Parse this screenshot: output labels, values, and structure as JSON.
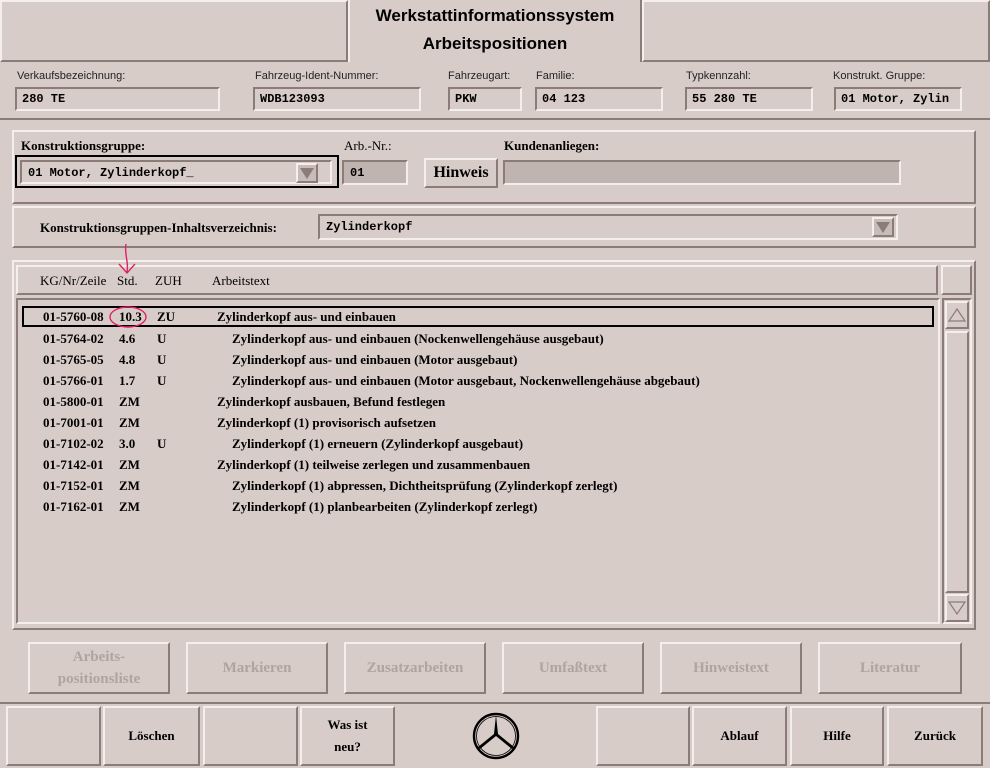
{
  "header": {
    "title_line1": "Werkstattinformationssystem",
    "title_line2": "Arbeitspositionen"
  },
  "vehicle": {
    "verkauf_label": "Verkaufsbezeichnung:",
    "verkauf_value": "280 TE",
    "fin_label": "Fahrzeug-Ident-Nummer:",
    "fin_value": "WDB123093",
    "art_label": "Fahrzeugart:",
    "art_value": "PKW",
    "familie_label": "Familie:",
    "familie_value": "04 123",
    "typ_label": "Typkennzahl:",
    "typ_value": "55 280 TE",
    "kg_label": "Konstrukt. Gruppe:",
    "kg_value": "01 Motor, Zylin"
  },
  "group": {
    "kg_label": "Konstruktionsgruppe:",
    "kg_value": "01 Motor, Zylinderkopf_",
    "arbnr_label": "Arb.-Nr.:",
    "arbnr_value": "01",
    "hinweis_label": "Hinweis",
    "kunden_label": "Kundenanliegen:",
    "kunden_value": ""
  },
  "contents": {
    "label": "Konstruktionsgruppen-Inhaltsverzeichnis:",
    "value": "Zylinderkopf"
  },
  "table": {
    "headers": {
      "kg": "KG/Nr/Zeile",
      "std": "Std.",
      "zuh": "ZUH",
      "text": "Arbeitstext"
    },
    "rows": [
      {
        "kg": "01-5760-08",
        "std": "10.3",
        "zuh": "ZU",
        "text": "Zylinderkopf aus- und einbauen",
        "indent": 0,
        "selected": true
      },
      {
        "kg": "01-5764-02",
        "std": "4.6",
        "zuh": "U",
        "text": "Zylinderkopf aus- und einbauen (Nockenwellengehäuse ausgebaut)",
        "indent": 1
      },
      {
        "kg": "01-5765-05",
        "std": "4.8",
        "zuh": "U",
        "text": "Zylinderkopf aus- und einbauen (Motor ausgebaut)",
        "indent": 1
      },
      {
        "kg": "01-5766-01",
        "std": "1.7",
        "zuh": "U",
        "text": "Zylinderkopf aus- und einbauen (Motor ausgebaut, Nockenwellengehäuse abgebaut)",
        "indent": 1
      },
      {
        "kg": "01-5800-01",
        "std": "ZM",
        "zuh": "",
        "text": "Zylinderkopf ausbauen, Befund festlegen",
        "indent": 0
      },
      {
        "kg": "01-7001-01",
        "std": "ZM",
        "zuh": "",
        "text": "Zylinderkopf (1) provisorisch aufsetzen",
        "indent": 0
      },
      {
        "kg": "01-7102-02",
        "std": "3.0",
        "zuh": "U",
        "text": "Zylinderkopf (1) erneuern (Zylinderkopf ausgebaut)",
        "indent": 1
      },
      {
        "kg": "01-7142-01",
        "std": "ZM",
        "zuh": "",
        "text": "Zylinderkopf (1) teilweise zerlegen und zusammenbauen",
        "indent": 0
      },
      {
        "kg": "01-7152-01",
        "std": "ZM",
        "zuh": "",
        "text": "Zylinderkopf (1) abpressen, Dichtheitsprüfung (Zylinderkopf zerlegt)",
        "indent": 1
      },
      {
        "kg": "01-7162-01",
        "std": "ZM",
        "zuh": "",
        "text": "Zylinderkopf (1) planbearbeiten (Zylinderkopf zerlegt)",
        "indent": 1
      }
    ]
  },
  "actions": {
    "arbeitspositionsliste_line1": "Arbeits-",
    "arbeitspositionsliste_line2": "positionsliste",
    "markieren": "Markieren",
    "zusatzarbeiten": "Zusatzarbeiten",
    "umfasstext": "Umfaßtext",
    "hinweistext": "Hinweistext",
    "literatur": "Literatur"
  },
  "bottom": {
    "loeschen": "Löschen",
    "was_ist_neu_line1": "Was ist",
    "was_ist_neu_line2": "neu?",
    "ablauf": "Ablauf",
    "hilfe": "Hilfe",
    "zurueck": "Zurück"
  },
  "colors": {
    "background": "#d8ccc8",
    "annotation": "#e0206a",
    "disabled_text": "#b0a4a0"
  }
}
